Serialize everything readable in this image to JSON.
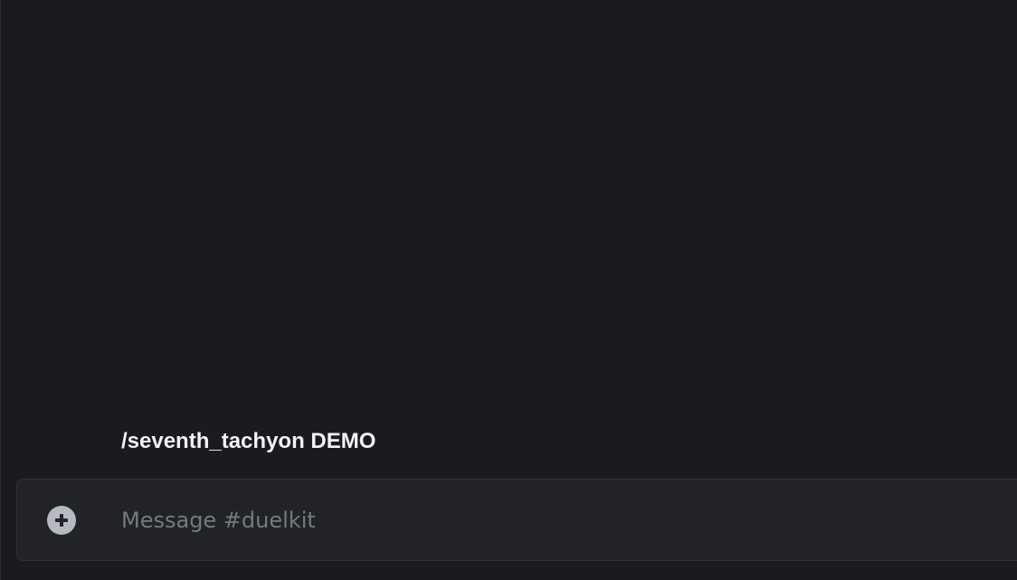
{
  "chat": {
    "message_text": "/seventh_tachyon DEMO",
    "composer_placeholder": "Message #duelkit"
  },
  "icons": {
    "attach": "plus-circle-icon"
  },
  "colors": {
    "background": "#1b1b1f",
    "composer": "#222327",
    "text": "#f2f3f5",
    "placeholder": "#747982",
    "icon": "#b5bac1"
  }
}
